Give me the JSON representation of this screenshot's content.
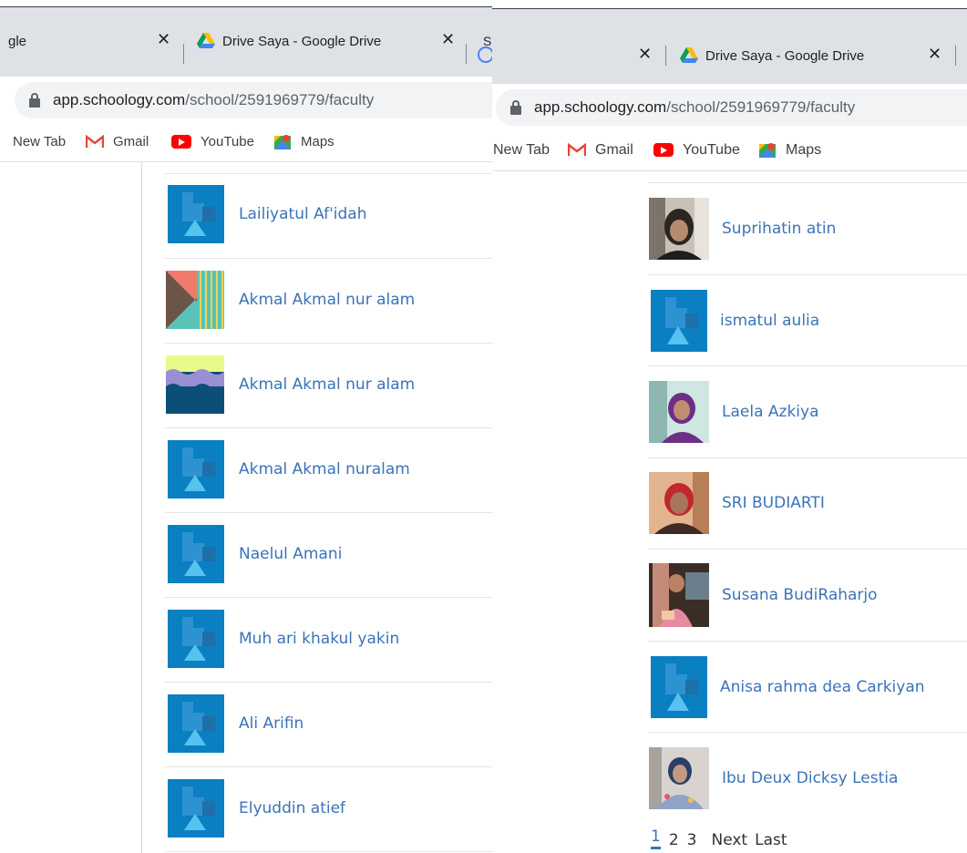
{
  "left": {
    "tabs": {
      "prev_title_fragment": "gle",
      "active_title": "Drive Saya - Google Drive",
      "next_title_fragment": "Se"
    },
    "address": {
      "host": "app.schoology.com",
      "path": "/school/2591969779/faculty"
    },
    "bookmarks": [
      "New Tab",
      "Gmail",
      "YouTube",
      "Maps"
    ],
    "members": [
      {
        "name": "Lailiyatul Af'idah",
        "avatar": "default"
      },
      {
        "name": "Akmal Akmal nur alam",
        "avatar": "triangles"
      },
      {
        "name": "Akmal Akmal nur alam",
        "avatar": "waves"
      },
      {
        "name": "Akmal Akmal nuralam",
        "avatar": "default"
      },
      {
        "name": "Naelul Amani",
        "avatar": "default"
      },
      {
        "name": "Muh ari khakul yakin",
        "avatar": "default"
      },
      {
        "name": "Ali Arifin",
        "avatar": "default"
      },
      {
        "name": "Elyuddin atief",
        "avatar": "default"
      }
    ]
  },
  "right": {
    "tabs": {
      "active_title": "Drive Saya - Google Drive"
    },
    "address": {
      "host": "app.schoology.com",
      "path": "/school/2591969779/faculty"
    },
    "bookmarks": [
      "New Tab",
      "Gmail",
      "YouTube",
      "Maps"
    ],
    "members": [
      {
        "name": "Suprihatin atin",
        "avatar": "photo-1"
      },
      {
        "name": "ismatul aulia",
        "avatar": "default"
      },
      {
        "name": "Laela Azkiya",
        "avatar": "photo-2"
      },
      {
        "name": "SRI BUDIARTI",
        "avatar": "photo-3"
      },
      {
        "name": "Susana BudiRaharjo",
        "avatar": "photo-4"
      },
      {
        "name": "Anisa rahma dea Carkiyan",
        "avatar": "default"
      },
      {
        "name": "Ibu Deux Dicksy Lestia",
        "avatar": "photo-5"
      }
    ],
    "pager": {
      "pages": [
        "1",
        "2",
        "3"
      ],
      "current": "1",
      "next": "Next",
      "last": "Last"
    }
  },
  "colors": {
    "tabbar": "#dee1e6",
    "link": "#3b73b9",
    "default_avatar": "#0a7fc2"
  }
}
